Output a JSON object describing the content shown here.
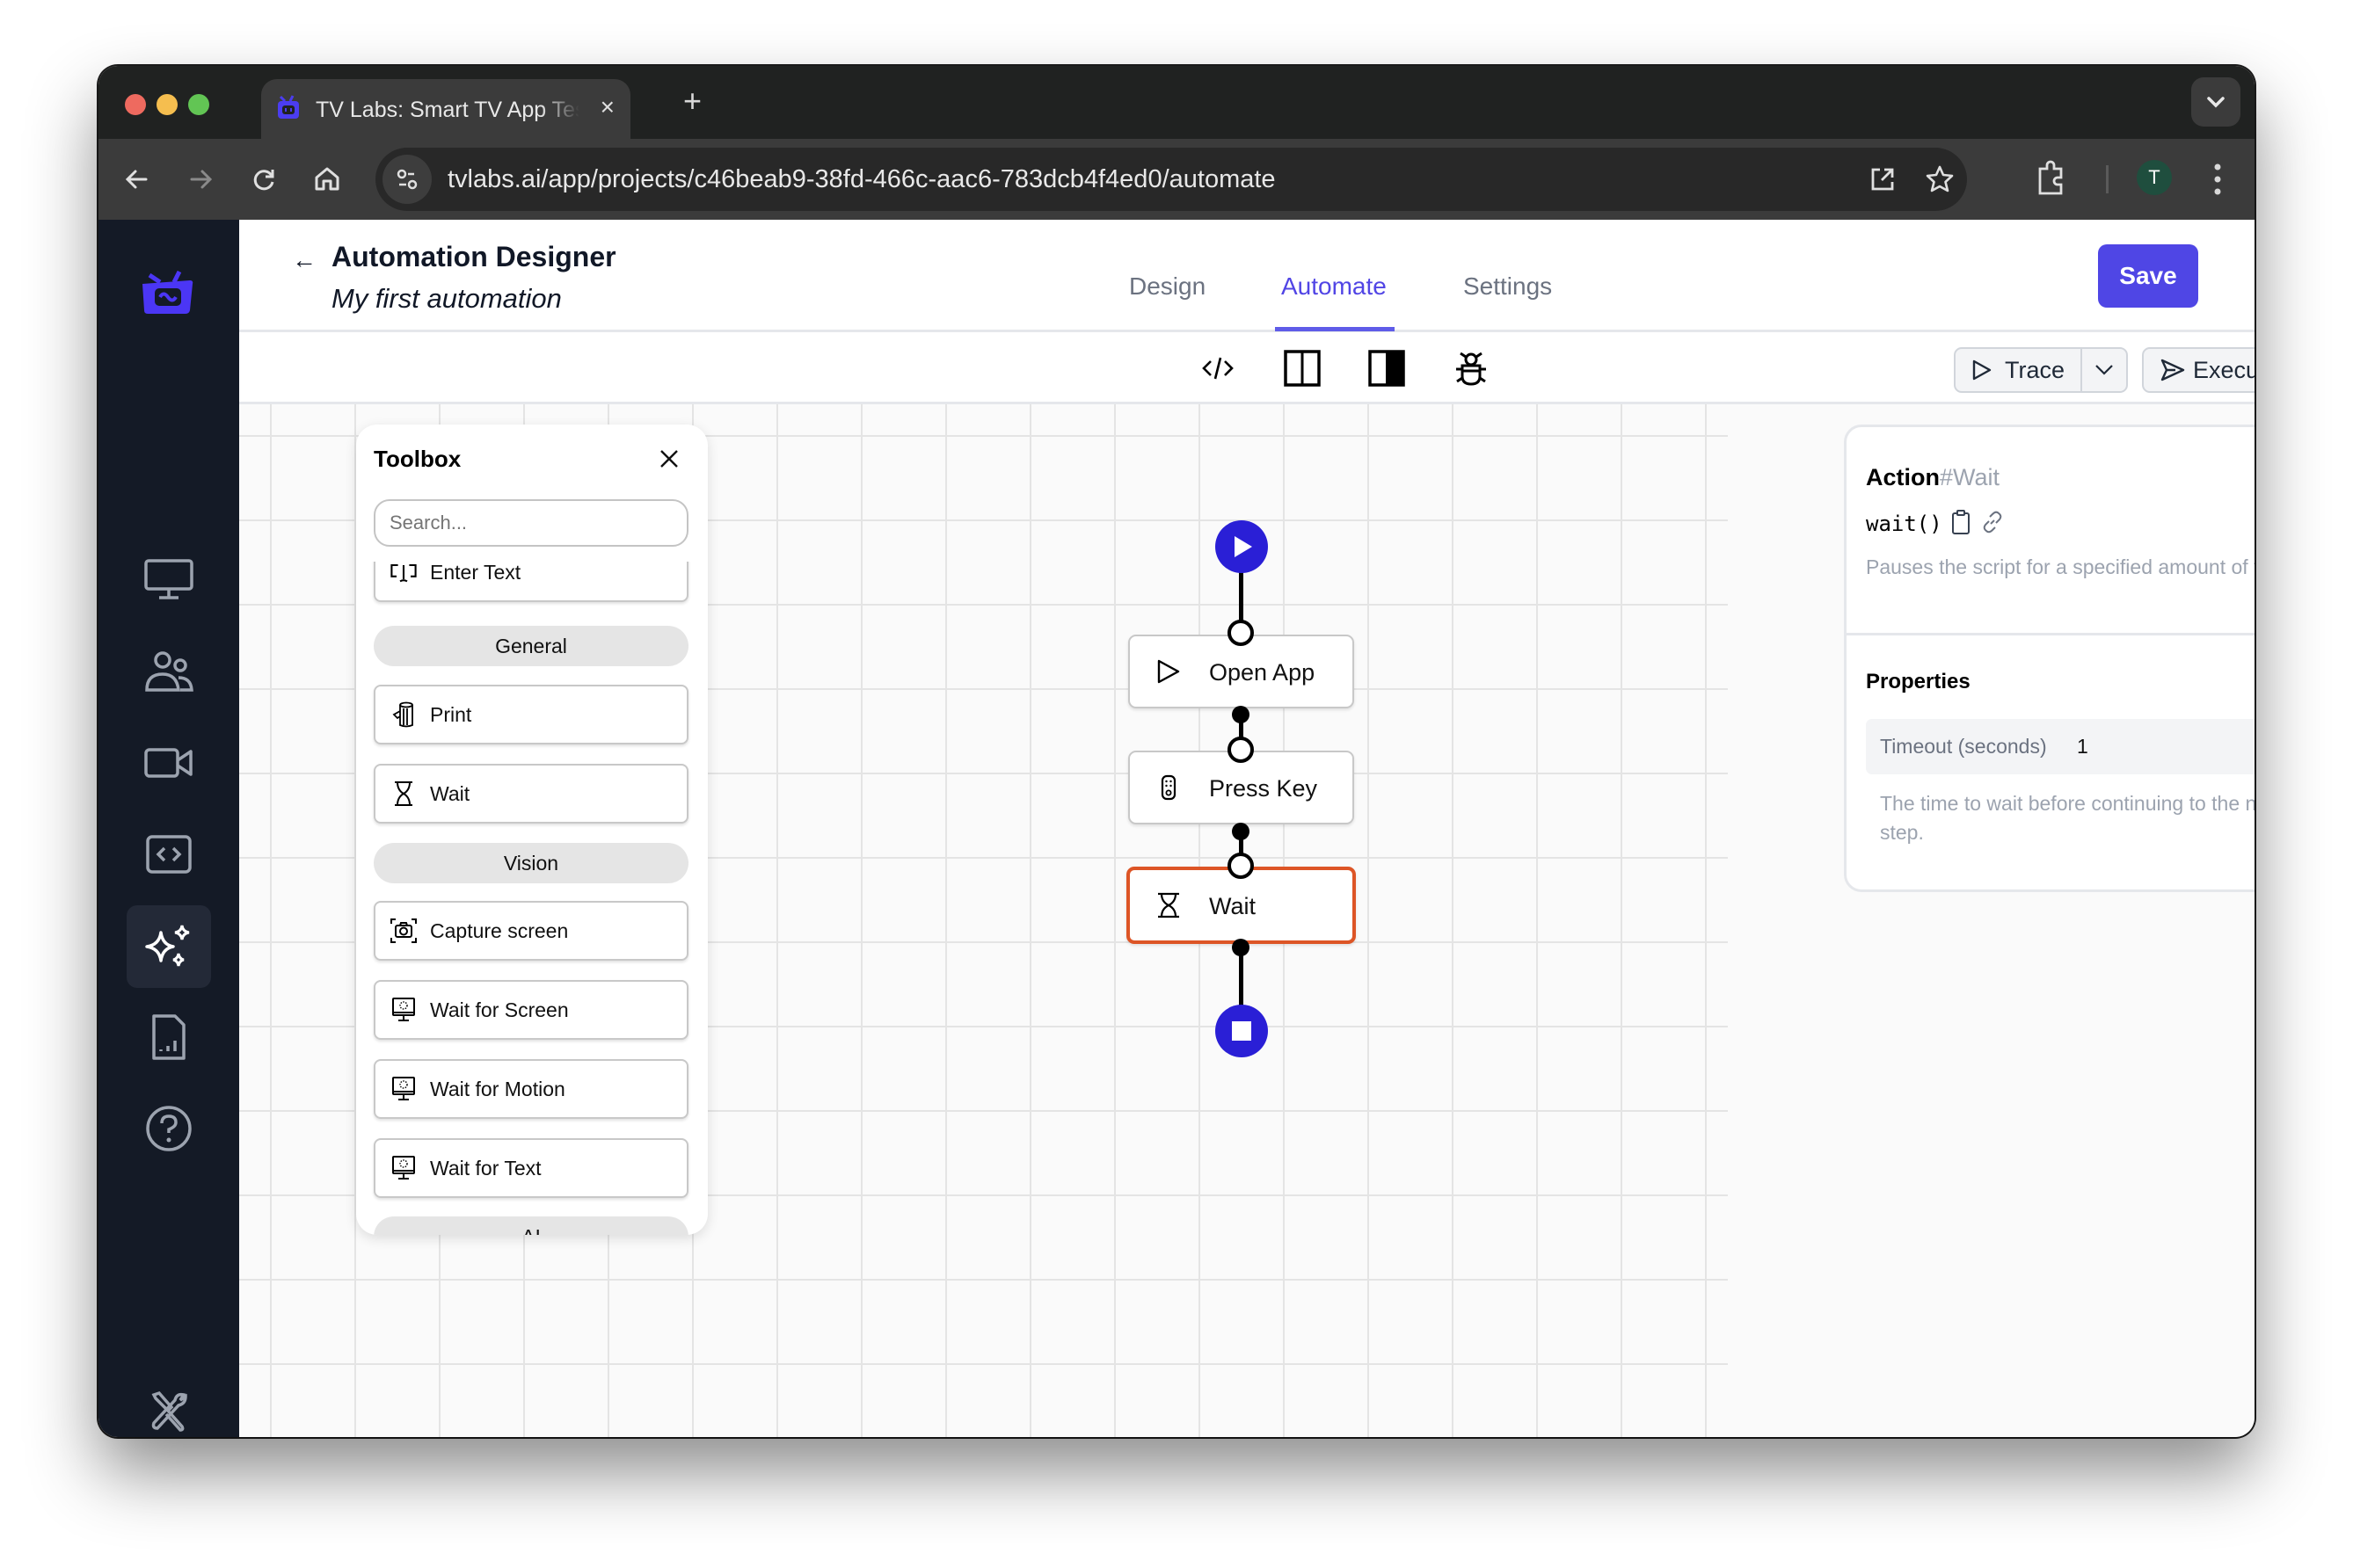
{
  "browser": {
    "tab_title": "TV Labs: Smart TV App Testing",
    "tab_close": "×",
    "new_tab": "+",
    "url": "tvlabs.ai/app/projects/c46beab9-38fd-466c-aac6-783dcb4f4ed0/automate",
    "profile_initial": "T",
    "colors": {
      "close": "#ee6a5f",
      "minimize": "#f5be4f",
      "maximize": "#62c554"
    }
  },
  "sidebar": {
    "logo": "tvlabs-logo-icon",
    "items": [
      {
        "icon": "monitor-icon",
        "label": "Devices"
      },
      {
        "icon": "users-icon",
        "label": "Team"
      },
      {
        "icon": "video-camera-icon",
        "label": "Sessions"
      },
      {
        "icon": "code-icon",
        "label": "Code"
      },
      {
        "icon": "sparkles-icon",
        "label": "Automation",
        "active": true
      },
      {
        "icon": "report-icon",
        "label": "Reports"
      },
      {
        "icon": "help-icon",
        "label": "Help"
      }
    ],
    "footer_icon": "tools-icon"
  },
  "header": {
    "back": "←",
    "title": "Automation Designer",
    "subtitle": "My first automation",
    "tabs": [
      {
        "label": "Design",
        "active": false
      },
      {
        "label": "Automate",
        "active": true
      },
      {
        "label": "Settings",
        "active": false
      }
    ],
    "save_label": "Save",
    "accent": "#4f46e5"
  },
  "toolbar": {
    "view_icons": [
      "code-view-icon",
      "split-view-icon",
      "panel-view-icon",
      "debug-icon"
    ],
    "trace_label": "Trace",
    "execute_label": "Execute All"
  },
  "toolbox": {
    "title": "Toolbox",
    "search_placeholder": "Search...",
    "items": [
      {
        "type": "item",
        "icon": "text-cursor-icon",
        "label": "Enter Text"
      },
      {
        "type": "group",
        "label": "General"
      },
      {
        "type": "item",
        "icon": "log-icon",
        "label": "Print"
      },
      {
        "type": "item",
        "icon": "hourglass-icon",
        "label": "Wait"
      },
      {
        "type": "group",
        "label": "Vision"
      },
      {
        "type": "item",
        "icon": "camera-capture-icon",
        "label": "Capture screen"
      },
      {
        "type": "item",
        "icon": "monitor-loading-icon",
        "label": "Wait for Screen"
      },
      {
        "type": "item",
        "icon": "monitor-loading-icon",
        "label": "Wait for Motion"
      },
      {
        "type": "item",
        "icon": "monitor-loading-icon",
        "label": "Wait for Text"
      },
      {
        "type": "group",
        "label": "AI"
      }
    ]
  },
  "flow": {
    "start": "start-node",
    "nodes": [
      {
        "icon": "play-outline-icon",
        "label": "Open App",
        "selected": false
      },
      {
        "icon": "remote-icon",
        "label": "Press Key",
        "selected": false
      },
      {
        "icon": "hourglass-icon",
        "label": "Wait",
        "selected": true
      }
    ],
    "end": "end-node",
    "selected_color": "#dd5526",
    "terminal_color": "#2a1fd6"
  },
  "controls": [
    {
      "name": "fit-view",
      "icon": "focus-icon",
      "enabled": true
    },
    {
      "name": "zoom-in",
      "icon": "zoom-in-icon",
      "enabled": true
    },
    {
      "name": "zoom-out",
      "icon": "zoom-out-icon",
      "enabled": true
    },
    {
      "name": "undo",
      "icon": "undo-icon",
      "enabled": true
    },
    {
      "name": "redo",
      "icon": "redo-icon",
      "enabled": false
    },
    {
      "name": "move",
      "icon": "move-icon",
      "enabled": false
    },
    {
      "name": "delete",
      "icon": "delete-icon",
      "enabled": true
    }
  ],
  "properties": {
    "kind": "Action",
    "name": "#Wait",
    "code": "wait()",
    "description": "Pauses the script for a specified amount of time.",
    "section_title": "Properties",
    "fields": [
      {
        "label": "Timeout (seconds)",
        "value": "1",
        "help": "The time to wait before continuing to the next step."
      }
    ]
  }
}
